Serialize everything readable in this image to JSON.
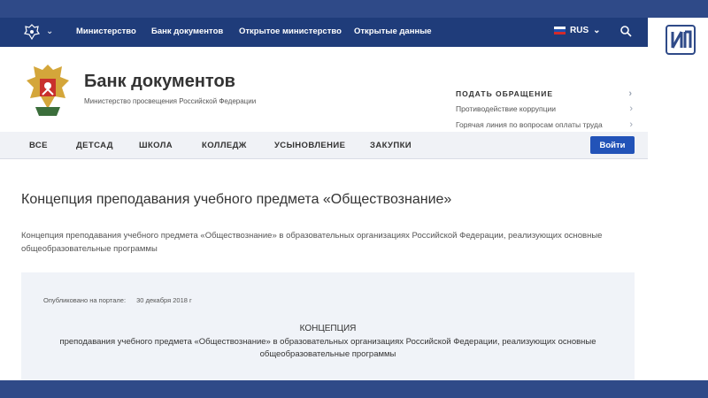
{
  "topnav": {
    "items": [
      "Министерство",
      "Банк документов",
      "Открытое министерство",
      "Открытые данные"
    ],
    "language": "RUS"
  },
  "header": {
    "title": "Банк документов",
    "subtitle": "Министерство просвещения Российской Федерации",
    "links": [
      "ПОДАТЬ ОБРАЩЕНИЕ",
      "Противодействие коррупции",
      "Горячая линия по вопросам оплаты труда"
    ]
  },
  "menubar": {
    "items": [
      "ВСЕ",
      "ДЕТСАД",
      "ШКОЛА",
      "КОЛЛЕДЖ",
      "УСЫНОВЛЕНИЕ",
      "ЗАКУПКИ"
    ],
    "login_label": "Войти"
  },
  "page": {
    "title": "Концепция преподавания учебного предмета «Обществознание»",
    "description": "Концепция преподавания учебного предмета «Обществознание» в образовательных организациях Российской Федерации, реализующих основные общеобразовательные программы"
  },
  "document": {
    "published_label": "Опубликовано на портале:",
    "published_date": "30 декабря 2018 г",
    "heading": "КОНЦЕПЦИЯ",
    "title_text": "преподавания учебного предмета «Обществознание» в образовательных организациях Российской Федерации, реализующих основные общеобразовательные программы"
  },
  "colors": {
    "band": "#2f4a88",
    "topnav": "#1f3c7a",
    "accent": "#2253b8",
    "doc_box": "#f0f3f8"
  },
  "icons": [
    "emblem-icon",
    "chevron-down-icon",
    "flag-icon",
    "search-icon",
    "chevron-right-icon",
    "brand-logo-icon"
  ]
}
